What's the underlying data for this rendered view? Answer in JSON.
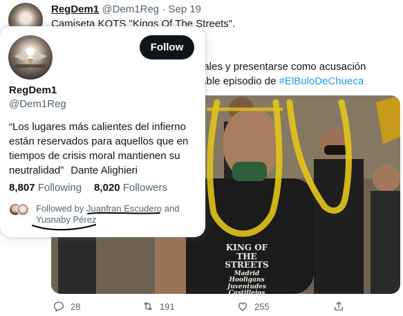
{
  "tweet": {
    "author_name": "RegDem1",
    "author_handle": "@Dem1Reg",
    "separator": "·",
    "date": "Sep 19",
    "line1": "Camiseta KOTS \"Kings Of The Streets\".",
    "line2": "gales y presentarse como acusación",
    "line3_prefix": "table episodio de ",
    "hashtag": "#ElBuloDeChueca",
    "shirt_title": "KING OF THE STREETS",
    "shirt_sub": "Madrid Hooligans Juventudes Castillejos",
    "actions": {
      "reply_count": "28",
      "retweet_count": "191",
      "like_count": "255"
    }
  },
  "hover_card": {
    "name": "RegDem1",
    "handle": "@Dem1Reg",
    "follow_label": "Follow",
    "bio_quote": "“Los lugares más calientes del infierno están reservados para aquellos que en tiempos de crisis moral mantienen su neutralidad”",
    "bio_author": "Dante Alighieri",
    "following_count": "8,807",
    "following_label": "Following",
    "followers_count": "8,020",
    "followers_label": "Followers",
    "followed_by_prefix": "Followed by",
    "followed_by_user1": "Juanfran Escudero",
    "followed_by_and": "and",
    "followed_by_user2": "Yusnaby Pérez"
  },
  "colors": {
    "text": "#0f1419",
    "secondary": "#536471",
    "link": "#1d9bf0",
    "follow_button": "#0f1419",
    "highlight_marks": "#e3c41a"
  },
  "icons": [
    "reply-icon",
    "retweet-icon",
    "like-icon",
    "share-icon"
  ]
}
